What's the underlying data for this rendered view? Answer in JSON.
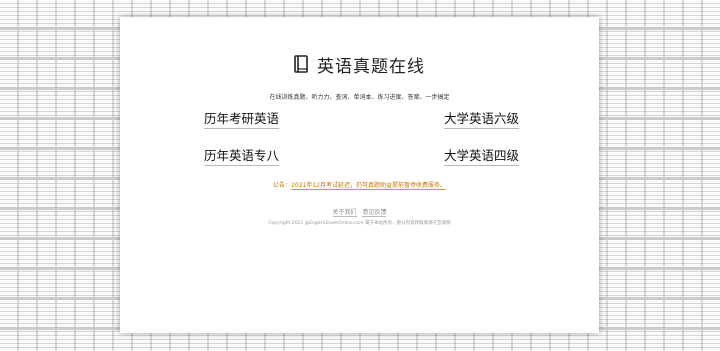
{
  "header": {
    "title": "英语真题在线",
    "subtitle": "在线训练真题、听力力、查词、单词本、练习进度、答案、一步搞定"
  },
  "links": [
    {
      "label": "历年考研英语"
    },
    {
      "label": "大学英语六级"
    },
    {
      "label": "历年英语专八"
    },
    {
      "label": "大学英语四级"
    }
  ],
  "notice": {
    "prefix": "公告：",
    "text": "2021年12月考试延迟，仍可真题助益提前暂停收费服务。"
  },
  "footer": {
    "about": "关于我们",
    "feedback": "意见反馈",
    "copyright": "Copyright 2021 @EnglishExamOnline.com 属于本站所有，部分内容转载来源于互联网"
  },
  "icons": {
    "title_icon": "book-icon"
  }
}
